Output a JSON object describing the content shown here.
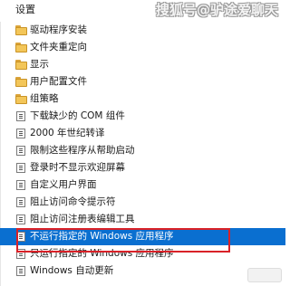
{
  "header": {
    "title": "设置",
    "watermark": "搜狐号@驴途爱聊天"
  },
  "items": [
    {
      "label": "驱动程序安装",
      "kind": "folder",
      "selected": false
    },
    {
      "label": "文件夹重定向",
      "kind": "folder",
      "selected": false
    },
    {
      "label": "显示",
      "kind": "folder",
      "selected": false
    },
    {
      "label": "用户配置文件",
      "kind": "folder",
      "selected": false
    },
    {
      "label": "组策略",
      "kind": "folder",
      "selected": false
    },
    {
      "label": "下载缺少的 COM 组件",
      "kind": "policy",
      "selected": false
    },
    {
      "label": "2000 年世纪转译",
      "kind": "policy",
      "selected": false
    },
    {
      "label": "限制这些程序从帮助启动",
      "kind": "policy",
      "selected": false
    },
    {
      "label": "登录时不显示欢迎屏幕",
      "kind": "policy",
      "selected": false
    },
    {
      "label": "自定义用户界面",
      "kind": "policy",
      "selected": false
    },
    {
      "label": "阻止访问命令提示符",
      "kind": "policy",
      "selected": false
    },
    {
      "label": "阻止访问注册表编辑工具",
      "kind": "policy",
      "selected": false
    },
    {
      "label": "不运行指定的 Windows 应用程序",
      "kind": "policy",
      "selected": true
    },
    {
      "label": "只运行指定的 Windows 应用程序",
      "kind": "policy",
      "selected": false
    },
    {
      "label": "Windows 自动更新",
      "kind": "policy",
      "selected": false
    }
  ],
  "colors": {
    "selection": "#0a6fd0",
    "highlight_box": "#d92128",
    "folder": "#f3c659"
  }
}
